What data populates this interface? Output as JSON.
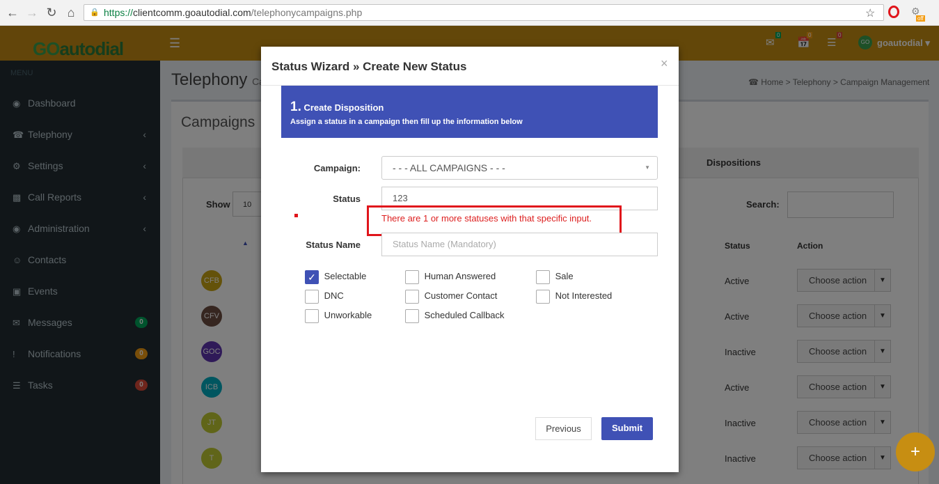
{
  "browser": {
    "url_proto": "https://",
    "url_host": "clientcomm.goautodial.com",
    "url_path": "/telephonycampaigns.php",
    "back_icon": "back-arrow-icon",
    "forward_icon": "forward-arrow-icon",
    "reload_icon": "reload-icon",
    "home_icon": "home-icon",
    "star_icon": "star-icon",
    "ext_badge": "off"
  },
  "app": {
    "logo_go": "GO",
    "logo_rest": "autodial",
    "header_badges": [
      "0",
      "0",
      "0"
    ],
    "user": "goautodial",
    "user_avatar": "GO"
  },
  "sidebar": {
    "menu_label": "MENU",
    "items": [
      {
        "label": "Dashboard",
        "icon": "dashboard-icon"
      },
      {
        "label": "Telephony",
        "icon": "phone-icon"
      },
      {
        "label": "Settings",
        "icon": "gear-icon"
      },
      {
        "label": "Call Reports",
        "icon": "bar-chart-icon"
      },
      {
        "label": "Administration",
        "icon": "dashboard-icon"
      },
      {
        "label": "Contacts",
        "icon": "users-icon"
      },
      {
        "label": "Events",
        "icon": "calendar-icon"
      },
      {
        "label": "Messages",
        "icon": "envelope-icon",
        "badge": "0"
      },
      {
        "label": "Notifications",
        "icon": "exclamation-icon",
        "badge": "0"
      },
      {
        "label": "Tasks",
        "icon": "tasks-icon",
        "badge": "0"
      }
    ]
  },
  "page": {
    "title": "Telephony",
    "title_sub": "Ca",
    "breadcrumb": [
      "Home",
      "Telephony",
      "Campaign Management"
    ],
    "box_title": "Campaigns",
    "tab_dispositions": "Dispositions",
    "show_label": "Show",
    "show_value": "10",
    "search_label": "Search:",
    "col_status": "Status",
    "col_action": "Action",
    "rows": [
      {
        "badge": "CFB",
        "color": "#c8a415",
        "status": "Active",
        "action": "Choose action"
      },
      {
        "badge": "CFV",
        "color": "#6d4c41",
        "status": "Active",
        "action": "Choose action"
      },
      {
        "badge": "GOC",
        "color": "#5e35b1",
        "status": "Inactive",
        "action": "Choose action"
      },
      {
        "badge": "ICB",
        "color": "#00acc1",
        "status": "Active",
        "action": "Choose action"
      },
      {
        "badge": "JT",
        "color": "#c0ca33",
        "status": "Inactive",
        "action": "Choose action"
      },
      {
        "badge": "T",
        "color": "#c0ca33",
        "status": "Inactive",
        "action": "Choose action"
      }
    ]
  },
  "modal": {
    "title": "Status Wizard » Create New Status",
    "close": "×",
    "step_num": "1.",
    "step_title": "Create Disposition",
    "step_sub": "Assign a status in a campaign then fill up the information below",
    "campaign_label": "Campaign:",
    "campaign_value": "- - - ALL CAMPAIGNS - - -",
    "status_label": "Status",
    "status_value": "123",
    "error": "There are 1 or more statuses with that specific input.",
    "status_name_label": "Status Name",
    "status_name_placeholder": "Status Name (Mandatory)",
    "checkboxes": [
      {
        "label": "Selectable",
        "checked": true
      },
      {
        "label": "Human Answered",
        "checked": false
      },
      {
        "label": "Sale",
        "checked": false
      },
      {
        "label": "DNC",
        "checked": false
      },
      {
        "label": "Customer Contact",
        "checked": false
      },
      {
        "label": "Not Interested",
        "checked": false
      },
      {
        "label": "Unworkable",
        "checked": false
      },
      {
        "label": "Scheduled Callback",
        "checked": false
      }
    ],
    "previous": "Previous",
    "submit": "Submit"
  },
  "fab": "+"
}
